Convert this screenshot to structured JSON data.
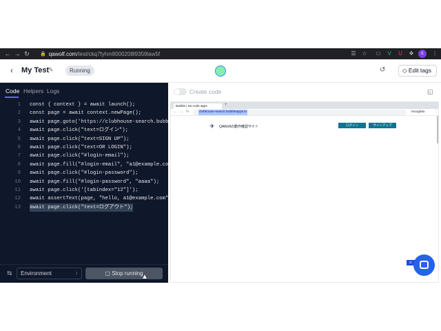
{
  "browser": {
    "url_host": "qawolf.com",
    "url_path": "/test/ckq7fyhm9000208l9359law5f",
    "profile_initial": "c"
  },
  "header": {
    "title": "My Test",
    "status": "Running",
    "edit_tags_label": "Edit tags"
  },
  "editor": {
    "tabs": [
      "Code",
      "Helpers",
      "Logs"
    ],
    "active_tab": "Code",
    "lines": [
      {
        "n": "1",
        "code": "const { context } = await launch();"
      },
      {
        "n": "2",
        "code": "const page = await context.newPage();"
      },
      {
        "n": "3",
        "code": "await page.goto('https://clubhouse-search.bubbl"
      },
      {
        "n": "4",
        "code": "await page.click(\"text=ログイン\");"
      },
      {
        "n": "5",
        "code": "await page.click(\"text=SIGN UP\");"
      },
      {
        "n": "6",
        "code": "await page.click(\"text=OR LOGIN\");"
      },
      {
        "n": "7",
        "code": "await page.click(\"#login-email\");"
      },
      {
        "n": "8",
        "code": "await page.fill(\"#login-email\", \"a1@example.com"
      },
      {
        "n": "9",
        "code": "await page.click(\"#login-password\");"
      },
      {
        "n": "10",
        "code": "await page.fill(\"#login-password\", \"aaaa\");"
      },
      {
        "n": "11",
        "code": "await page.click('[tabindex=\"12\"]');"
      },
      {
        "n": "12",
        "code": "await assertText(page, \"hello, a1@example.com\","
      },
      {
        "n": "13",
        "code": "await page.click(\"text=ログアウト\");"
      }
    ],
    "environment_label": "Environment",
    "stop_label": "Stop running"
  },
  "preview": {
    "create_code_label": "Create code",
    "mini_tab_title": "Bubble | No-code apps",
    "mini_url": "clubhouse-search.bubbleapps.io",
    "incognito_label": "Incognito",
    "site_name": "QAWolfの動作確認サイト",
    "login_label": "ログイン",
    "signup_label": "サインアップ"
  }
}
